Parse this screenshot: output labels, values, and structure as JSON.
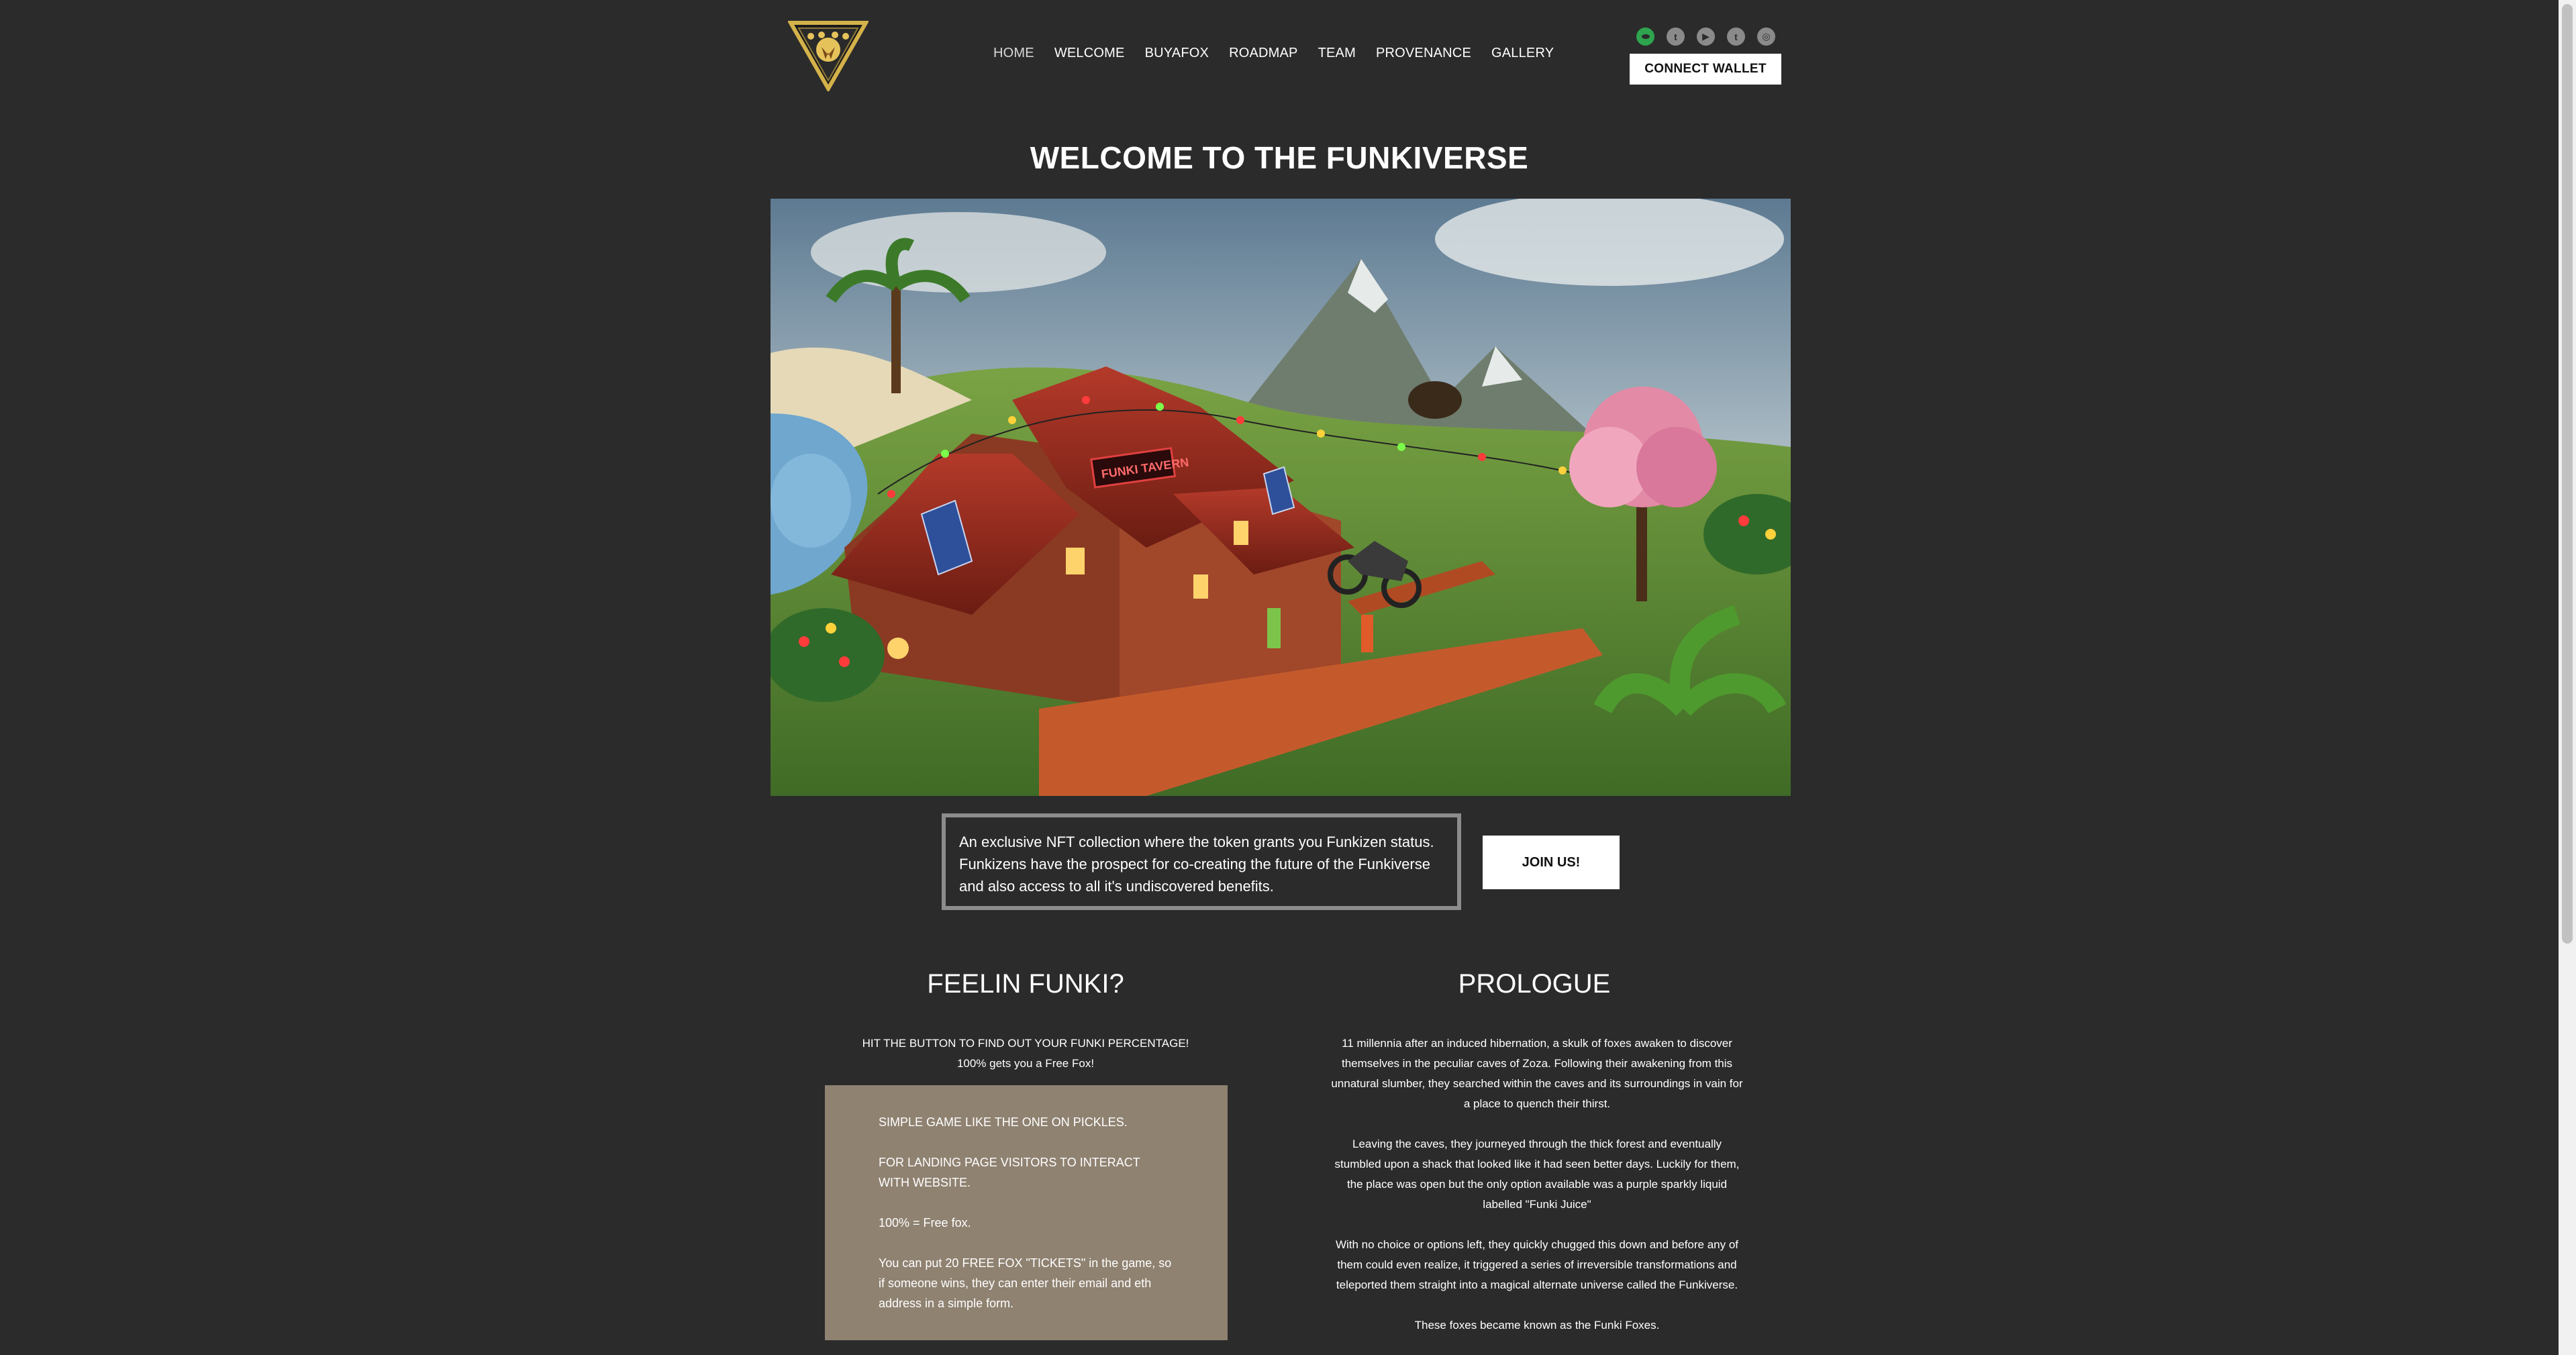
{
  "header": {
    "logo_icon": "fox-triangle-logo-icon",
    "nav": [
      "HOME",
      "WELCOME",
      "BUYAFOX",
      "ROADMAP",
      "TEAM",
      "PROVENANCE",
      "GALLERY"
    ],
    "active_nav": "HOME",
    "socials": [
      {
        "name": "discord-icon",
        "color": "#2ea44f",
        "glyph": ""
      },
      {
        "name": "twitter-icon",
        "glyph": "t"
      },
      {
        "name": "youtube-icon",
        "glyph": "▶"
      },
      {
        "name": "tumblr-icon",
        "glyph": "t"
      },
      {
        "name": "instagram-icon",
        "glyph": "◎"
      }
    ],
    "connect_wallet": "CONNECT WALLET"
  },
  "hero": {
    "title": "WELCOME TO THE FUNKIVERSE",
    "tavern_sign": "FUNKI TAVERN"
  },
  "intro": {
    "text": "An exclusive NFT collection where the token grants you Funkizen status. Funkizens have the prospect for co-creating the future of the Funkiverse and also access to all it's undiscovered benefits.",
    "join_label": "JOIN US!"
  },
  "feelin": {
    "title": "FEELIN FUNKI?",
    "sub_line1": "HIT THE BUTTON TO FIND OUT YOUR FUNKI PERCENTAGE!",
    "sub_line2": "100% gets you a Free Fox!",
    "box": [
      "SIMPLE GAME LIKE THE ONE ON PICKLES.",
      "FOR LANDING PAGE VISITORS TO INTERACT WITH WEBSITE.",
      "100% = Free fox.",
      "You can put 20 FREE FOX \"TICKETS\" in the game, so if someone wins, they can enter their email and eth address in a simple form."
    ]
  },
  "prologue": {
    "title": "PROLOGUE",
    "paragraphs": [
      "11 millennia after an induced hibernation, a skulk of foxes awaken to discover themselves in the peculiar caves of Zoza. Following their awakening from this unnatural slumber, they searched within the caves and its surroundings in vain for a place to quench their thirst.",
      "Leaving the caves, they journeyed through the thick forest and eventually stumbled upon a shack that looked like it had seen better days. Luckily for them, the place was open but the only option available was a purple sparkly liquid labelled \"Funki Juice\"",
      "With no choice or options left, they quickly chugged this down and before any of them could even realize, it triggered a series of irreversible transformations and teleported them straight into a magical alternate universe called the Funkiverse.",
      "These foxes became known as the Funki Foxes."
    ]
  }
}
